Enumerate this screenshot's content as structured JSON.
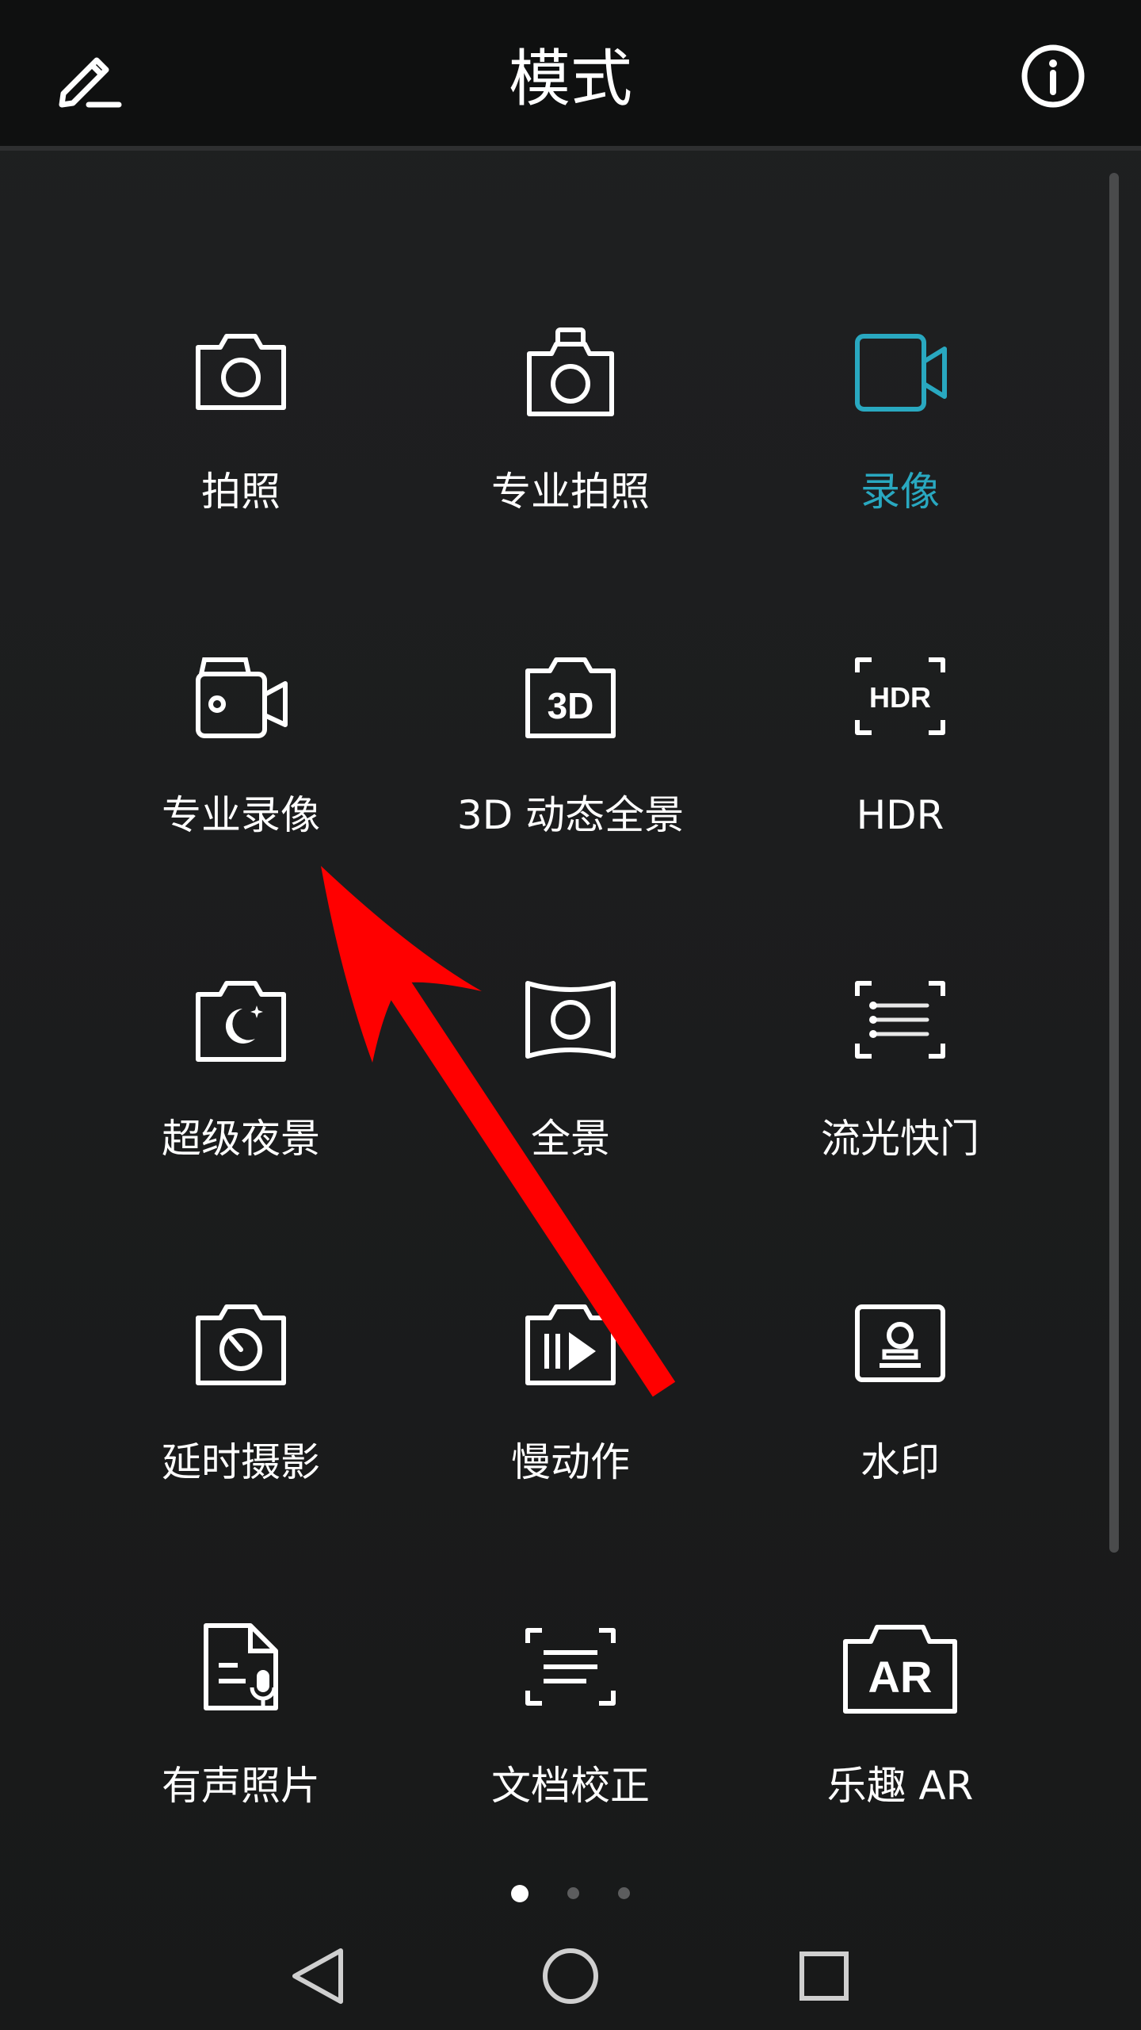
{
  "header": {
    "title": "模式",
    "edit_icon": "pencil-edit-icon",
    "info_icon": "info-icon"
  },
  "accent_color": "#29a8c0",
  "modes": [
    {
      "label": "拍照",
      "icon": "camera-icon",
      "active": false
    },
    {
      "label": "专业拍照",
      "icon": "pro-camera-icon",
      "active": false
    },
    {
      "label": "录像",
      "icon": "video-camera-icon",
      "active": true
    },
    {
      "label": "专业录像",
      "icon": "pro-video-icon",
      "active": false
    },
    {
      "label": "3D 动态全景",
      "icon": "3d-panorama-icon",
      "active": false
    },
    {
      "label": "HDR",
      "icon": "hdr-icon",
      "active": false
    },
    {
      "label": "超级夜景",
      "icon": "night-mode-icon",
      "active": false
    },
    {
      "label": "全景",
      "icon": "panorama-icon",
      "active": false
    },
    {
      "label": "流光快门",
      "icon": "light-painting-icon",
      "active": false
    },
    {
      "label": "延时摄影",
      "icon": "time-lapse-icon",
      "active": false
    },
    {
      "label": "慢动作",
      "icon": "slow-motion-icon",
      "active": false
    },
    {
      "label": "水印",
      "icon": "watermark-icon",
      "active": false
    },
    {
      "label": "有声照片",
      "icon": "audio-photo-icon",
      "active": false
    },
    {
      "label": "文档校正",
      "icon": "document-scan-icon",
      "active": false
    },
    {
      "label": "乐趣 AR",
      "icon": "ar-fun-icon",
      "active": false
    }
  ],
  "pagination": {
    "pages": 3,
    "current": 1
  },
  "navbar": [
    "back-icon",
    "home-icon",
    "recents-icon"
  ],
  "annotation": {
    "color": "#ff0000",
    "icon": "red-arrow-annotation"
  }
}
